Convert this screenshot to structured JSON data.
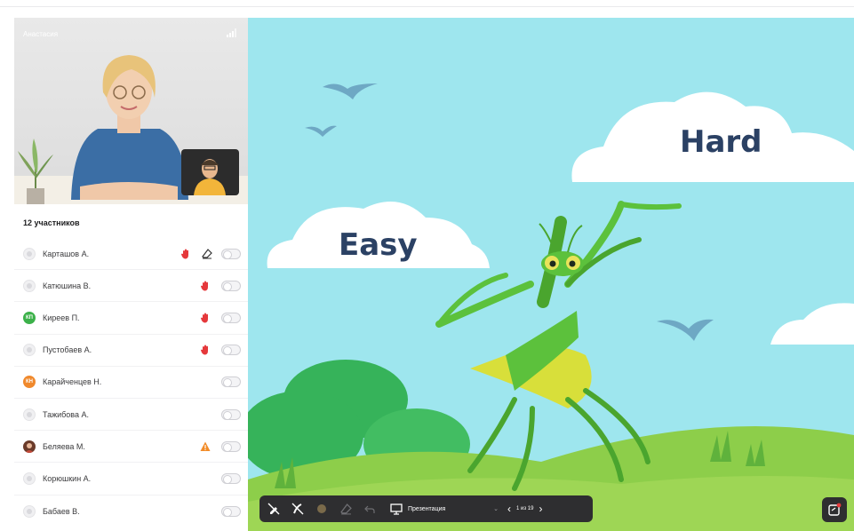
{
  "teacher": {
    "name": "Анастасия"
  },
  "participants": {
    "count_label": "12 участников",
    "items": [
      {
        "name": "Карташов А.",
        "avatar": "placeholder",
        "hand": true,
        "eraser": true,
        "warning": false
      },
      {
        "name": "Катюшина В.",
        "avatar": "placeholder",
        "hand": true,
        "eraser": false,
        "warning": false
      },
      {
        "name": "Киреев П.",
        "avatar": "initials",
        "initials": "КП",
        "avatar_color": "#3cb14a",
        "hand": true,
        "eraser": false,
        "warning": false
      },
      {
        "name": "Пустобаев А.",
        "avatar": "placeholder",
        "hand": true,
        "eraser": false,
        "warning": false
      },
      {
        "name": "Карайченцев Н.",
        "avatar": "initials",
        "initials": "КН",
        "avatar_color": "#f0892c",
        "hand": false,
        "eraser": false,
        "warning": false
      },
      {
        "name": "Тажибова А.",
        "avatar": "placeholder",
        "hand": false,
        "eraser": false,
        "warning": false
      },
      {
        "name": "Беляева М.",
        "avatar": "photo",
        "hand": false,
        "eraser": false,
        "warning": true
      },
      {
        "name": "Корюшкин А.",
        "avatar": "placeholder",
        "hand": false,
        "eraser": false,
        "warning": false
      },
      {
        "name": "Бабаев В.",
        "avatar": "placeholder",
        "hand": false,
        "eraser": false,
        "warning": false
      }
    ]
  },
  "slide": {
    "word_hard": "Hard",
    "word_easy": "Easy"
  },
  "toolbar": {
    "presentation_label": "Презентация",
    "page_label": "1 из 19",
    "icons": [
      "pen-off-icon",
      "draw-off-icon",
      "color-dot-icon",
      "eraser-icon",
      "undo-icon",
      "presentation-icon",
      "chevron-down-icon",
      "prev-arrow-icon",
      "next-arrow-icon"
    ]
  },
  "colors": {
    "hand": "#e5383b",
    "warning": "#f28c28",
    "sky": "#9ee6ee",
    "title": "#2b4164",
    "toolbar": "#2e2e30"
  }
}
